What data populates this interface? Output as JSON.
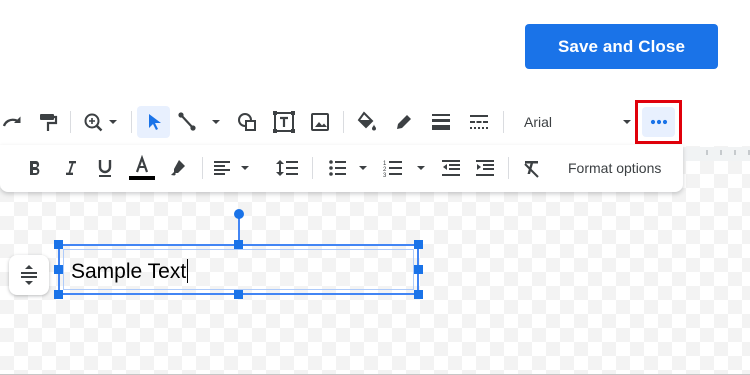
{
  "header": {
    "save_close_label": "Save and Close"
  },
  "toolbar": {
    "font_name": "Arial",
    "icons": [
      "redo-icon",
      "paint-format-icon",
      "zoom-icon",
      "select-icon",
      "line-icon",
      "shape-icon",
      "text-box-icon",
      "image-icon",
      "fill-color-icon",
      "border-color-icon",
      "border-weight-icon",
      "border-dash-icon",
      "more-icon"
    ]
  },
  "format_bar": {
    "format_options_label": "Format options",
    "icons": [
      "bold-icon",
      "italic-icon",
      "underline-icon",
      "text-color-icon",
      "highlight-icon",
      "align-icon",
      "line-spacing-icon",
      "bulleted-list-icon",
      "numbered-list-icon",
      "decrease-indent-icon",
      "increase-indent-icon",
      "clear-formatting-icon"
    ]
  },
  "canvas": {
    "textbox_text": "Sample Text"
  },
  "colors": {
    "accent": "#1a73e8",
    "highlight_border": "#e0000b",
    "text_color_bar": "#000000"
  }
}
